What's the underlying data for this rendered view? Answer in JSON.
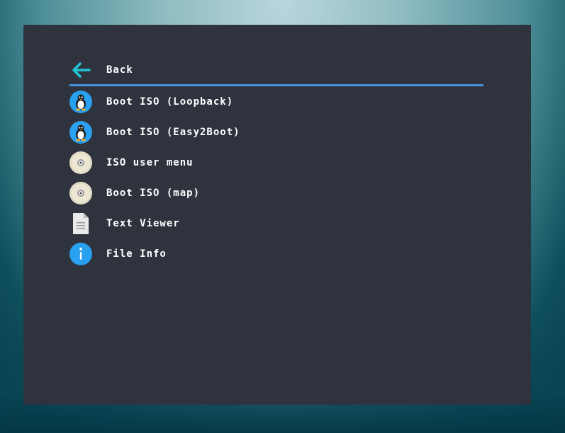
{
  "colors": {
    "panel": "#2f333e",
    "text": "#ffffff",
    "selection_line": "#4a90d9",
    "back_arrow": "#22c3d6",
    "blue_icon": "#2aa0f0"
  },
  "menu": {
    "items": [
      {
        "label": "Back",
        "icon": "back-arrow-icon"
      },
      {
        "label": "Boot ISO (Loopback)",
        "icon": "linux-tux-icon"
      },
      {
        "label": "Boot ISO (Easy2Boot)",
        "icon": "linux-tux-icon"
      },
      {
        "label": "ISO user menu",
        "icon": "disc-icon"
      },
      {
        "label": "Boot ISO (map)",
        "icon": "disc-icon"
      },
      {
        "label": "Text Viewer",
        "icon": "text-document-icon"
      },
      {
        "label": "File Info",
        "icon": "info-icon"
      }
    ]
  }
}
